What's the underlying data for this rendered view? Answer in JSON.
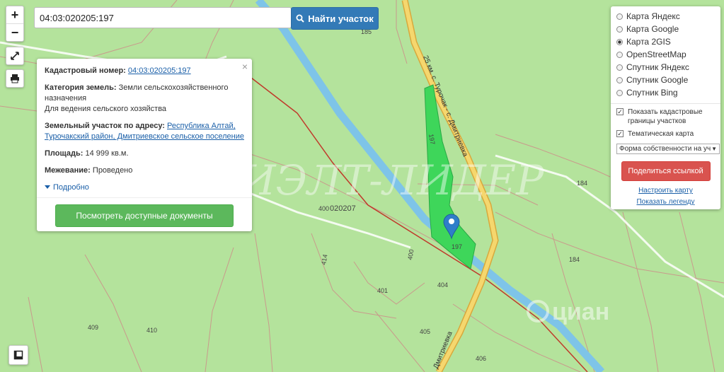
{
  "search": {
    "value": "04:03:020205:197",
    "button_label": "Найти участок"
  },
  "controls": {
    "zoom_in": "+",
    "zoom_out": "−"
  },
  "popup": {
    "close": "×",
    "cadastral_label": "Кадастровый номер:",
    "cadastral_value": "04:03:020205:197",
    "category_label": "Категория земель:",
    "category_value": "Земли сельскохозяйственного назначения",
    "use_value": "Для ведения сельского хозяйства",
    "address_label": "Земельный участок по адресу:",
    "address_link1": "Республика Алтай,",
    "address_link2": "Турочакский район, Дмитриевское сельское поселение",
    "area_label": "Площадь:",
    "area_value": "14 999 кв.м.",
    "survey_label": "Межевание:",
    "survey_value": "Проведено",
    "more_label": "Подробно",
    "docs_button": "Посмотреть доступные документы"
  },
  "layers": {
    "base_maps": [
      {
        "label": "Карта Яндекс",
        "selected": false
      },
      {
        "label": "Карта Google",
        "selected": false
      },
      {
        "label": "Карта 2GIS",
        "selected": true
      },
      {
        "label": "OpenStreetMap",
        "selected": false
      },
      {
        "label": "Спутник Яндекс",
        "selected": false
      },
      {
        "label": "Спутник Google",
        "selected": false
      },
      {
        "label": "Спутник Bing",
        "selected": false
      }
    ],
    "overlays": [
      {
        "label": "Показать кадастровые границы участков",
        "checked": true
      },
      {
        "label": "Тематическая карта",
        "checked": true
      }
    ],
    "ownership_select": "Форма собственности на уч",
    "share_button": "Поделиться ссылкой",
    "configure_link": "Настроить карту",
    "legend_link": "Показать легенду"
  },
  "map": {
    "road_label_1": "25 км. с. Турочак - с. Дмитриевка",
    "road_label_2": "Дмитриевка",
    "parcel_labels": [
      "185",
      "197",
      "197",
      "184",
      "184",
      "400",
      "400",
      "020207",
      "414",
      "401",
      "404",
      "405",
      "409",
      "410",
      "406"
    ],
    "watermark": "РИЭЛТ-ЛИДЕР",
    "logo_text": "циан",
    "colors": {
      "background": "#b4e39c",
      "river": "#7ec4e8",
      "road": "#f5d76e",
      "parcel_fill": "#3ed65a",
      "marker": "#2f7ec9"
    }
  }
}
